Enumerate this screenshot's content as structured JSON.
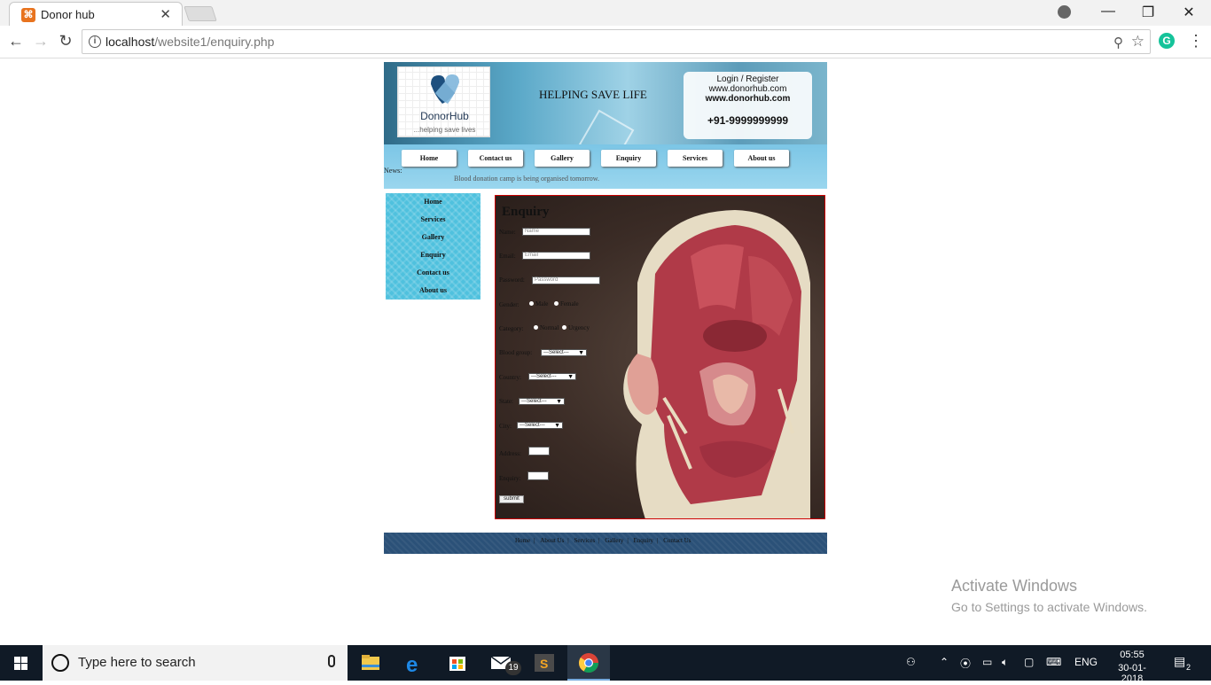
{
  "browser": {
    "tab_title": "Donor hub",
    "url_host": "localhost",
    "url_path": "/website1/enquiry.php"
  },
  "header": {
    "logo_name": "DonorHub",
    "logo_tagline": "...helping save lives",
    "slogan": "HELPING SAVE LIFE",
    "login_register": "Login / Register",
    "website_1": "www.donorhub.com",
    "website_2": "www.donorhub.com",
    "phone": "+91-9999999999"
  },
  "nav": {
    "items": [
      "Home",
      "Contact us",
      "Gallery",
      "Enquiry",
      "Services",
      "About us"
    ]
  },
  "news": {
    "label": "News:",
    "text": "Blood donation camp is being organised tomorrow."
  },
  "sidebar": {
    "items": [
      "Home",
      "Services",
      "Gallery",
      "Enquiry",
      "Contact us",
      "About us"
    ]
  },
  "form": {
    "title": "Enquiry",
    "name_label": "Name:",
    "name_placeholder": "Name",
    "email_label": "Email:",
    "email_placeholder": "Email",
    "password_label": "Password:",
    "password_placeholder": "Password",
    "gender_label": "Gender:",
    "gender_options": [
      "Male",
      "Female"
    ],
    "category_label": "Category:",
    "category_options": [
      "Normal",
      "Urgency"
    ],
    "blood_group_label": "Blood group:",
    "blood_group_value": "---Select---",
    "country_label": "Country:",
    "country_value": "---Select---",
    "state_label": "State:",
    "state_value": "---Select---",
    "city_label": "City:",
    "city_value": "---Select---",
    "address_label": "Address:",
    "enquiry_label": "Enquiry:",
    "submit_label": "submit"
  },
  "footer": {
    "links": [
      "Home",
      "About Us",
      "Services",
      "Gallery",
      "Enquiry",
      "Contact Us"
    ],
    "separator": "|"
  },
  "watermark": {
    "line1": "Activate Windows",
    "line2": "Go to Settings to activate Windows."
  },
  "taskbar": {
    "search_placeholder": "Type here to search",
    "mail_badge": "19",
    "language": "ENG",
    "time": "05:55",
    "date": "30-01-2018",
    "notification_count": "2"
  }
}
